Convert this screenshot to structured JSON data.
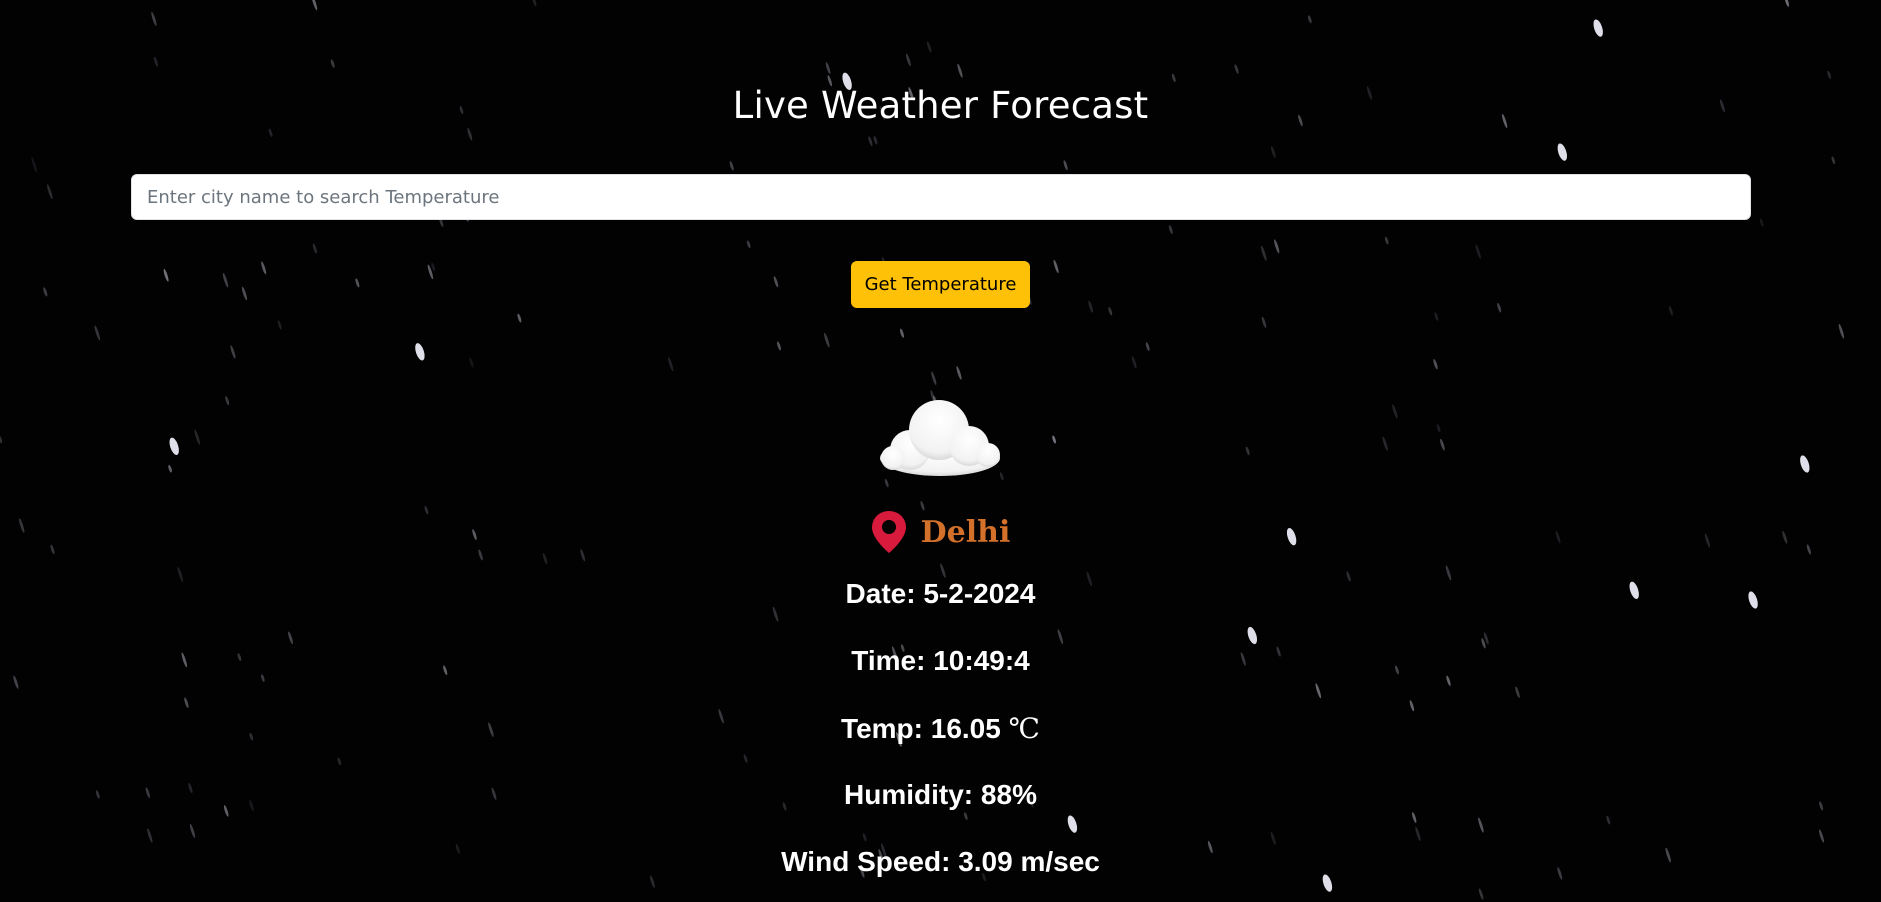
{
  "header": {
    "title": "Live Weather Forecast"
  },
  "search": {
    "placeholder": "Enter city name to search Temperature",
    "value": ""
  },
  "action": {
    "button_label": "Get Temperature"
  },
  "weather": {
    "icon": "cloud-icon",
    "location_icon": "map-pin-icon",
    "city": "Delhi",
    "date_label": "Date: ",
    "date_value": "5-2-2024",
    "time_label": "Time: ",
    "time_value": "10:49:4",
    "temp_label": "Temp: ",
    "temp_value": "16.05",
    "temp_unit": "℃",
    "humidity_label": "Humidity: ",
    "humidity_value": "88%",
    "wind_label": "Wind Speed: ",
    "wind_value": "3.09 m/sec"
  },
  "theme": {
    "background": "#000000",
    "button_color": "#ffc107",
    "city_color": "#d3702a",
    "pin_color": "#d81b3c"
  }
}
